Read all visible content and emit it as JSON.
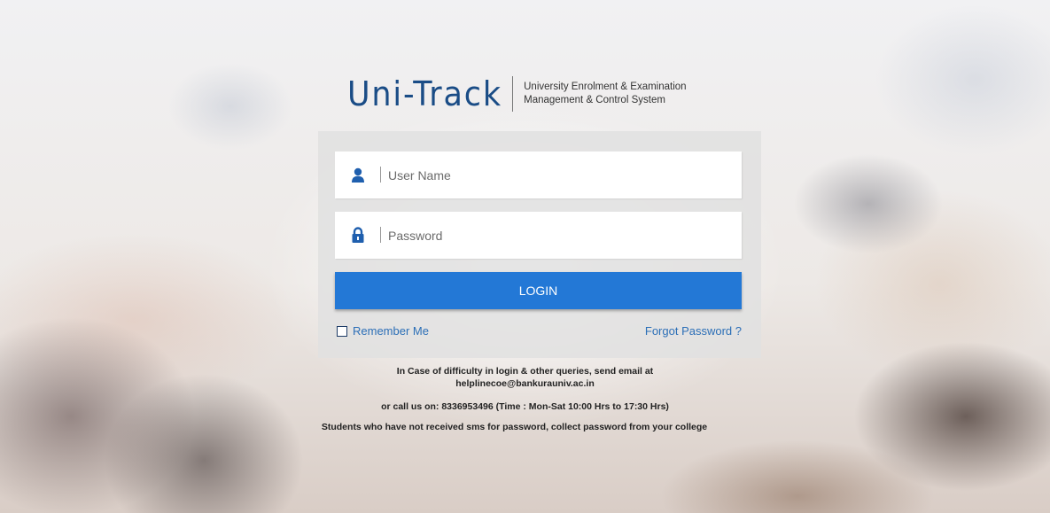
{
  "logo": {
    "title": "Uni-Track",
    "tagline_line1": "University Enrolment & Examination",
    "tagline_line2": "Management & Control System"
  },
  "form": {
    "username_placeholder": "User Name",
    "password_placeholder": "Password",
    "user_icon": "user-icon",
    "lock_icon": "lock-icon",
    "login_label": "LOGIN",
    "remember_label": "Remember Me",
    "remember_checked": false,
    "forgot_label": "Forgot Password ?"
  },
  "help": {
    "line1": "In Case of difficulty in login & other queries, send email at",
    "email": "helplinecoe@bankurauniv.ac.in",
    "phone_line": "or call us on: 8336953496 (Time : Mon-Sat 10:00 Hrs to 17:30 Hrs)",
    "sms_line": "Students who have not received sms for password, collect password from your college"
  },
  "colors": {
    "accent": "#2378d6",
    "brand": "#1a4c86",
    "link": "#2c6fb7",
    "icon": "#1f5fae"
  }
}
